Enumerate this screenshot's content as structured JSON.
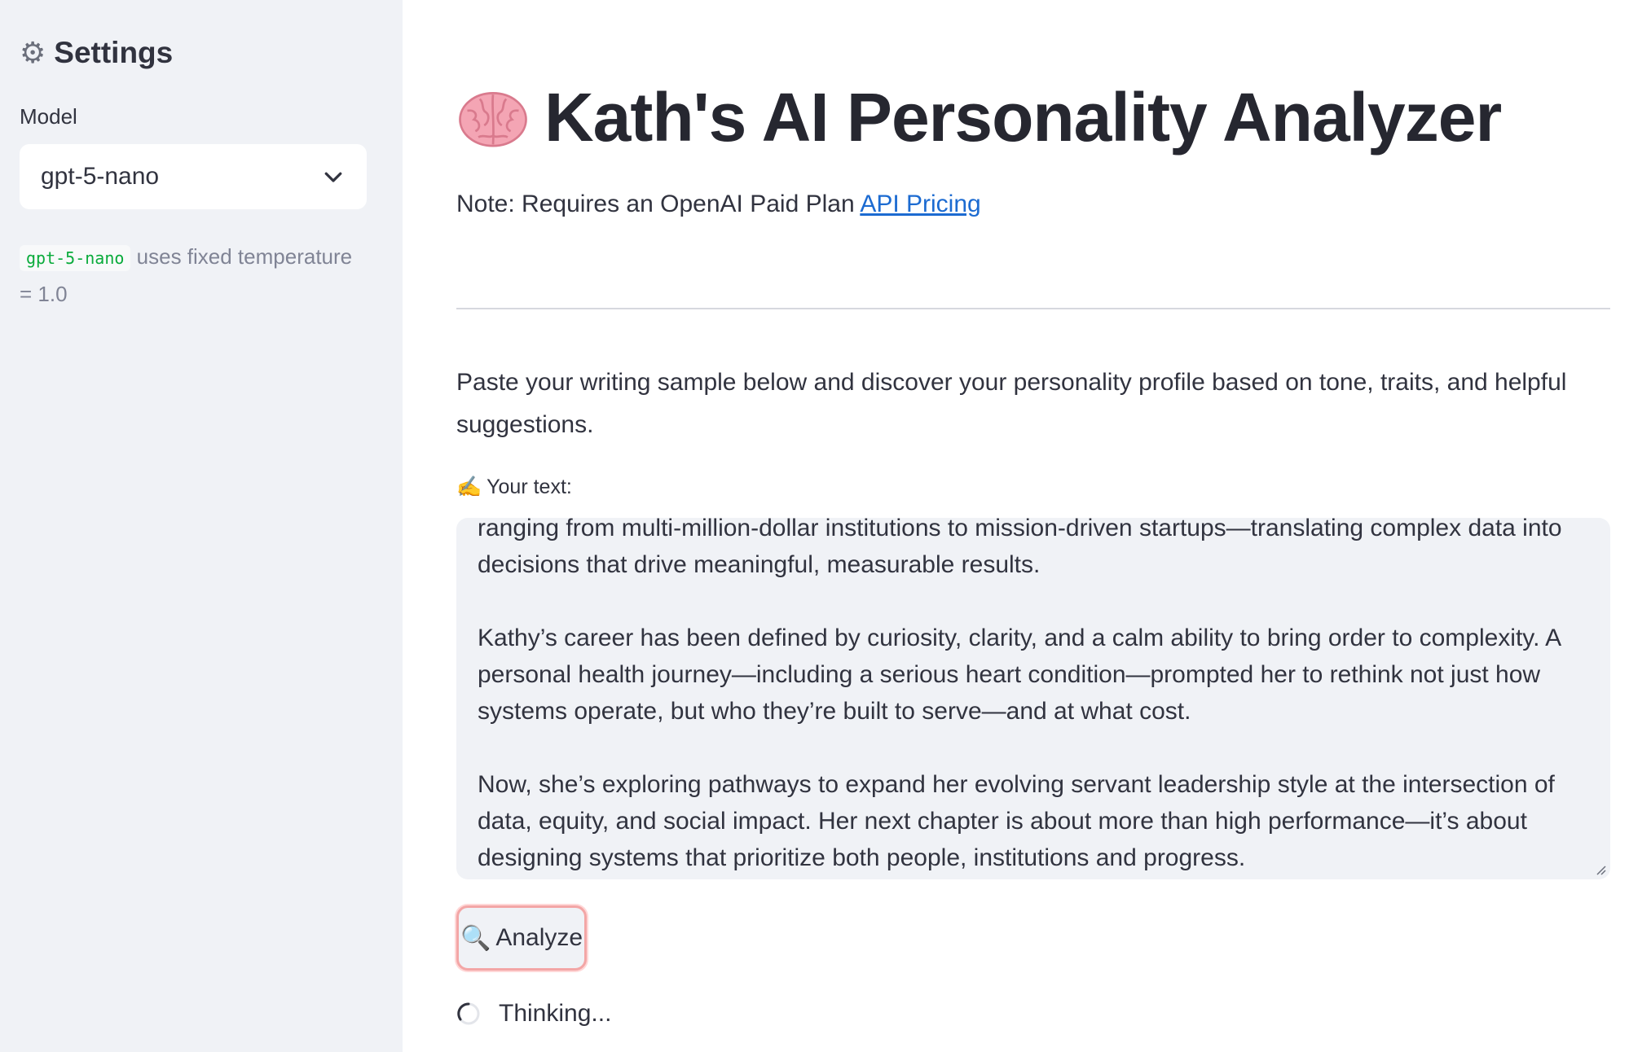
{
  "sidebar": {
    "title": "Settings",
    "icon": "gear-icon",
    "model_label": "Model",
    "model_selected": "gpt-5-nano",
    "caption_code": "gpt-5-nano",
    "caption_text": " uses fixed temperature = 1.0"
  },
  "main": {
    "title": "Kath's AI Personality Analyzer",
    "title_icon": "brain-icon",
    "note_text": "Note: Requires an OpenAI Paid Plan ",
    "note_link": "API Pricing",
    "intro": "Paste your writing sample below and discover your personality profile based on tone, traits, and helpful suggestions.",
    "text_label_icon": "✍️",
    "text_label": "Your text:",
    "text_paragraphs": [
      "ranging from multi-million-dollar institutions to mission-driven startups—translating complex data into decisions that drive meaningful, measurable results.",
      "Kathy’s career has been defined by curiosity, clarity, and a calm ability to bring order to complexity. A personal health journey—including a serious heart condition—prompted her to rethink not just how systems operate, but who they’re built to serve—and at what cost.",
      "Now, she’s exploring pathways to expand her evolving servant leadership style at the intersection of data, equity, and social impact. Her next chapter is about more than high performance—it’s about designing systems that prioritize both people, institutions and progress."
    ],
    "analyze_icon": "🔍",
    "analyze_label": "Analyze",
    "status": "Thinking..."
  },
  "colors": {
    "sidebar_bg": "#f0f2f6",
    "link": "#1c6bd1",
    "code_text": "#09ab3b",
    "button_focus_border": "#f3a6a6"
  }
}
